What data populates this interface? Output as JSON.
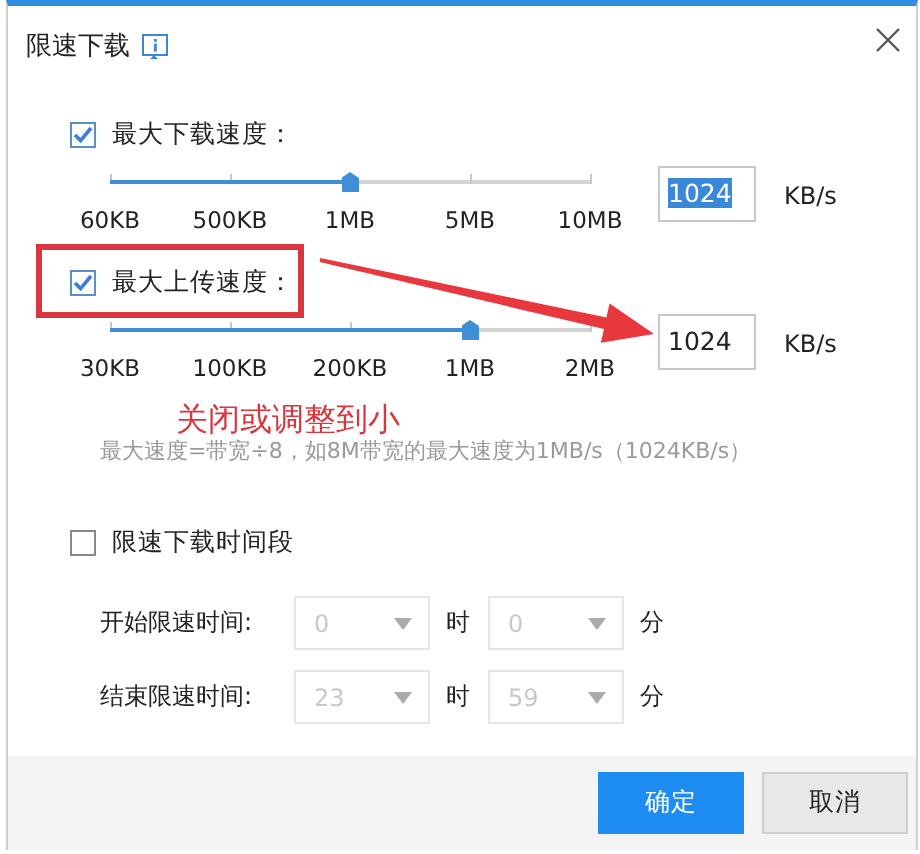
{
  "window": {
    "title": "限速下载"
  },
  "speed_limits": [
    {
      "label": "最大下载速度：",
      "checked": true,
      "level": 0.5,
      "ticks": [
        "60KB",
        "500KB",
        "1MB",
        "5MB",
        "10MB"
      ],
      "value": "1024",
      "value_selected": true,
      "unit": "KB/s",
      "annotated": false
    },
    {
      "label": "最大上传速度：",
      "checked": true,
      "level": 0.75,
      "ticks": [
        "30KB",
        "100KB",
        "200KB",
        "1MB",
        "2MB"
      ],
      "value": "1024",
      "value_selected": false,
      "unit": "KB/s",
      "annotated": true
    }
  ],
  "annotation": {
    "text": "关闭或调整到小"
  },
  "note": "最大速度=带宽÷8，如8M带宽的最大速度为1MB/s（1024KB/s）",
  "schedule": {
    "label": "限速下载时间段",
    "checked": false,
    "rows": [
      {
        "label": "开始限速时间:",
        "hour": "0",
        "hour_unit": "时",
        "minute": "0",
        "minute_unit": "分",
        "disabled": true
      },
      {
        "label": "结束限速时间:",
        "hour": "23",
        "hour_unit": "时",
        "minute": "59",
        "minute_unit": "分",
        "disabled": true
      }
    ]
  },
  "buttons": [
    {
      "label": "确定",
      "kind": "primary"
    },
    {
      "label": "取消",
      "kind": "secondary"
    }
  ]
}
